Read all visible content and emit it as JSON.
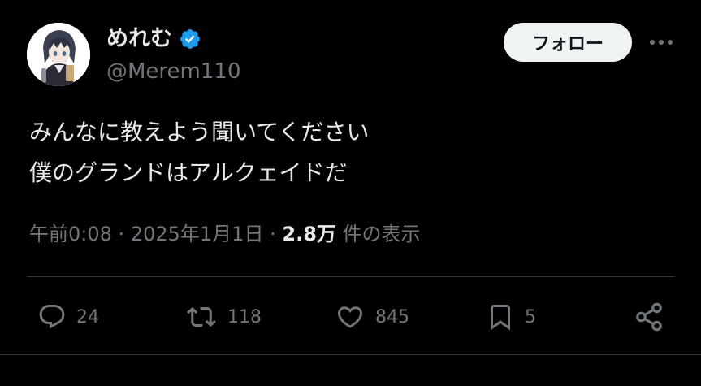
{
  "author": {
    "display_name": "めれむ",
    "handle": "@Merem110",
    "verified": true
  },
  "follow_button": {
    "label": "フォロー"
  },
  "more_menu": {
    "icon": "more-horizontal-icon"
  },
  "tweet": {
    "lines": [
      "みんなに教えよう聞いてください",
      "僕のグランドはアルクェイドだ"
    ]
  },
  "meta": {
    "time": "午前0:08",
    "separator": "·",
    "date": "2025年1月1日",
    "views_count": "2.8万",
    "views_label": "件の表示"
  },
  "actions": {
    "reply": {
      "icon": "reply-icon",
      "count": "24"
    },
    "repost": {
      "icon": "repost-icon",
      "count": "118"
    },
    "like": {
      "icon": "heart-icon",
      "count": "845"
    },
    "bookmark": {
      "icon": "bookmark-icon",
      "count": "5"
    },
    "share": {
      "icon": "share-icon"
    }
  },
  "colors": {
    "background": "#000000",
    "text_primary": "#e7e9ea",
    "text_secondary": "#71767b",
    "verified_blue": "#1d9bf0",
    "button_bg": "#eff3f4",
    "divider": "#2f3336"
  }
}
